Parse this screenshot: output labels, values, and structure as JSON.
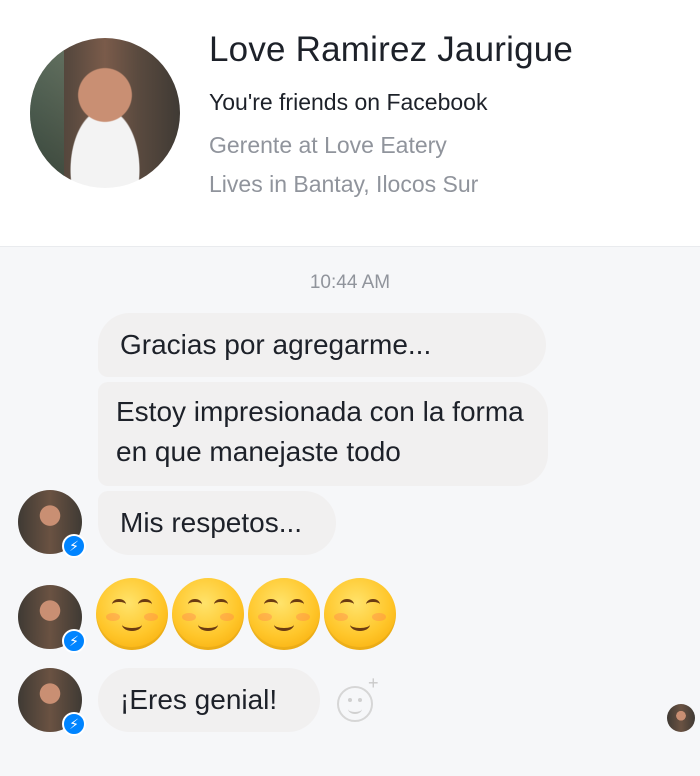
{
  "profile": {
    "name": "Love Ramirez Jaurigue",
    "friendship": "You're friends on Facebook",
    "work": "Gerente at Love Eatery",
    "location": "Lives in Bantay, Ilocos Sur"
  },
  "conversation": {
    "timestamp": "10:44 AM",
    "messages": [
      {
        "text": "Gracias por agregarme..."
      },
      {
        "text": "Estoy impresionada con la forma en que manejaste todo"
      },
      {
        "text": "Mis respetos..."
      },
      {
        "emoji_count": 4,
        "emoji": "smiling-face-with-smiling-eyes"
      },
      {
        "text": "¡Eres genial!"
      }
    ]
  },
  "icons": {
    "messenger_badge": "messenger-icon",
    "react_button": "add-reaction-icon"
  },
  "colors": {
    "bubble": "#f1f0f0",
    "chat_background": "#f6f7f9",
    "messenger_blue": "#0084ff",
    "secondary_text": "#90949c"
  }
}
